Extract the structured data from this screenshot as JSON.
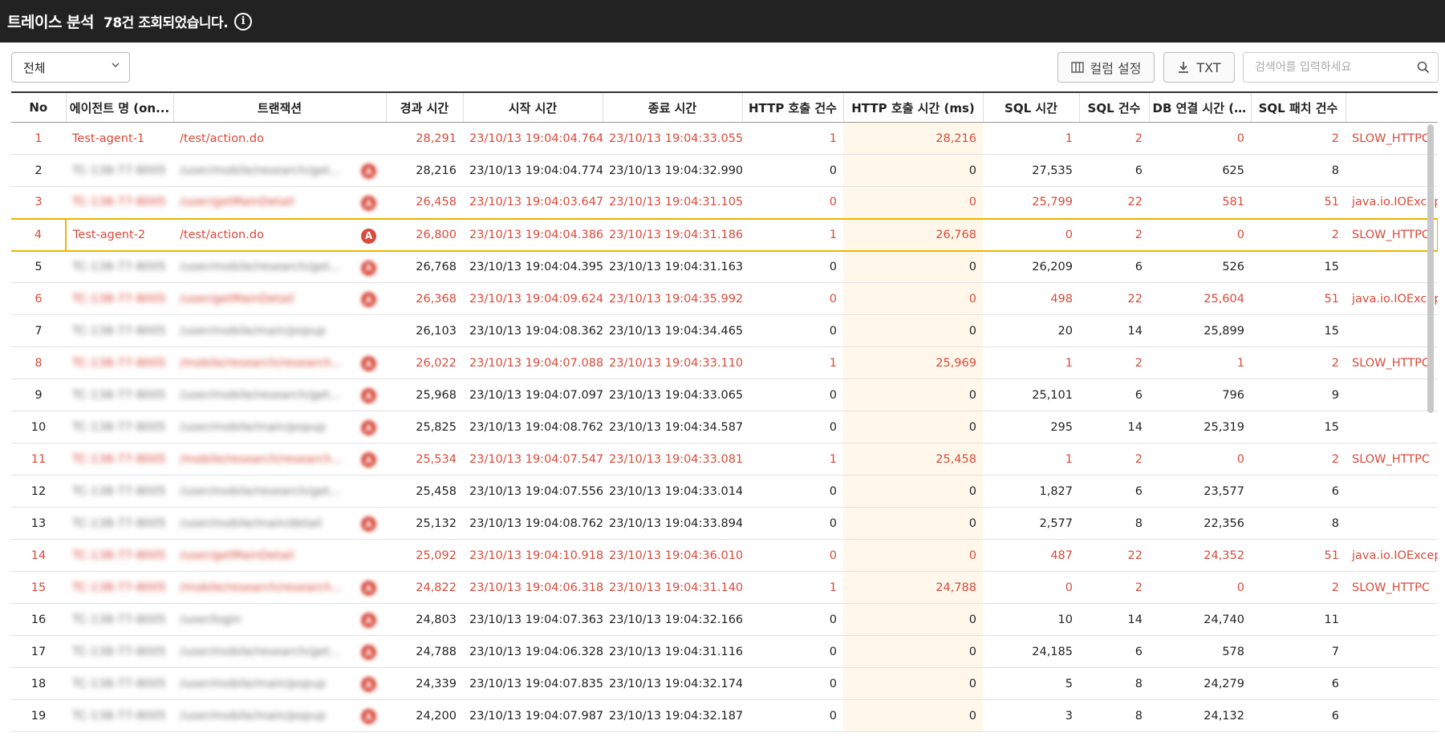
{
  "header": {
    "title": "트레이스 분석",
    "count_text": "78건 조회되었습니다.",
    "info_icon": "info-icon"
  },
  "toolbar": {
    "filter_value": "전체",
    "column_settings_label": "컬럼 설정",
    "txt_label": "TXT",
    "search_placeholder": "검색어를 입력하세요"
  },
  "table": {
    "columns": [
      "No",
      "에이전트 명 (on...",
      "트랜잭션",
      "경과 시간",
      "시작 시간",
      "종료 시간",
      "HTTP 호출 건수",
      "HTTP 호출 시간 (ms)",
      "SQL 시간",
      "SQL 건수",
      "DB 연결 시간 (...",
      "SQL 패치 건수",
      ""
    ],
    "rows": [
      {
        "no": "1",
        "agent": "Test-agent-1",
        "tx": "/test/action.do",
        "mark": "",
        "elapsed": "28,291",
        "start": "23/10/13 19:04:04.764",
        "end": "23/10/13 19:04:33.055",
        "http_cnt": "1",
        "http_time": "28,216",
        "sql_time": "1",
        "sql_cnt": "2",
        "db_conn": "0",
        "fetch": "2",
        "error": "SLOW_HTTPC",
        "err": true,
        "blur": false
      },
      {
        "no": "2",
        "agent": "TC-138-77-8005",
        "tx": "/user/mobile/research/get...",
        "mark": "A",
        "elapsed": "28,216",
        "start": "23/10/13 19:04:04.774",
        "end": "23/10/13 19:04:32.990",
        "http_cnt": "0",
        "http_time": "0",
        "sql_time": "27,535",
        "sql_cnt": "6",
        "db_conn": "625",
        "fetch": "8",
        "error": "",
        "err": false,
        "blur": true
      },
      {
        "no": "3",
        "agent": "TC-138-77-8005",
        "tx": "/user/getMainDetail",
        "mark": "A",
        "elapsed": "26,458",
        "start": "23/10/13 19:04:03.647",
        "end": "23/10/13 19:04:31.105",
        "http_cnt": "0",
        "http_time": "0",
        "sql_time": "25,799",
        "sql_cnt": "22",
        "db_conn": "581",
        "fetch": "51",
        "error": "java.io.IOExcept",
        "err": true,
        "blur": true
      },
      {
        "no": "4",
        "agent": "Test-agent-2",
        "tx": "/test/action.do",
        "mark": "A",
        "elapsed": "26,800",
        "start": "23/10/13 19:04:04.386",
        "end": "23/10/13 19:04:31.186",
        "http_cnt": "1",
        "http_time": "26,768",
        "sql_time": "0",
        "sql_cnt": "2",
        "db_conn": "0",
        "fetch": "2",
        "error": "SLOW_HTTPC",
        "err": true,
        "blur": false,
        "sel": true
      },
      {
        "no": "5",
        "agent": "TC-138-77-8005",
        "tx": "/user/mobile/research/get...",
        "mark": "A",
        "elapsed": "26,768",
        "start": "23/10/13 19:04:04.395",
        "end": "23/10/13 19:04:31.163",
        "http_cnt": "0",
        "http_time": "0",
        "sql_time": "26,209",
        "sql_cnt": "6",
        "db_conn": "526",
        "fetch": "15",
        "error": "",
        "err": false,
        "blur": true
      },
      {
        "no": "6",
        "agent": "TC-138-77-8005",
        "tx": "/user/getMainDetail",
        "mark": "A",
        "elapsed": "26,368",
        "start": "23/10/13 19:04:09.624",
        "end": "23/10/13 19:04:35.992",
        "http_cnt": "0",
        "http_time": "0",
        "sql_time": "498",
        "sql_cnt": "22",
        "db_conn": "25,604",
        "fetch": "51",
        "error": "java.io.IOExcept",
        "err": true,
        "blur": true
      },
      {
        "no": "7",
        "agent": "TC-138-77-8005",
        "tx": "/user/mobile/main/popup",
        "mark": "",
        "elapsed": "26,103",
        "start": "23/10/13 19:04:08.362",
        "end": "23/10/13 19:04:34.465",
        "http_cnt": "0",
        "http_time": "0",
        "sql_time": "20",
        "sql_cnt": "14",
        "db_conn": "25,899",
        "fetch": "15",
        "error": "",
        "err": false,
        "blur": true
      },
      {
        "no": "8",
        "agent": "TC-138-77-8005",
        "tx": "/mobile/research/research...",
        "mark": "A",
        "elapsed": "26,022",
        "start": "23/10/13 19:04:07.088",
        "end": "23/10/13 19:04:33.110",
        "http_cnt": "1",
        "http_time": "25,969",
        "sql_time": "1",
        "sql_cnt": "2",
        "db_conn": "1",
        "fetch": "2",
        "error": "SLOW_HTTPC",
        "err": true,
        "blur": true
      },
      {
        "no": "9",
        "agent": "TC-138-77-8005",
        "tx": "/user/mobile/research/get...",
        "mark": "A",
        "elapsed": "25,968",
        "start": "23/10/13 19:04:07.097",
        "end": "23/10/13 19:04:33.065",
        "http_cnt": "0",
        "http_time": "0",
        "sql_time": "25,101",
        "sql_cnt": "6",
        "db_conn": "796",
        "fetch": "9",
        "error": "",
        "err": false,
        "blur": true
      },
      {
        "no": "10",
        "agent": "TC-138-77-8005",
        "tx": "/user/mobile/main/popup",
        "mark": "A",
        "elapsed": "25,825",
        "start": "23/10/13 19:04:08.762",
        "end": "23/10/13 19:04:34.587",
        "http_cnt": "0",
        "http_time": "0",
        "sql_time": "295",
        "sql_cnt": "14",
        "db_conn": "25,319",
        "fetch": "15",
        "error": "",
        "err": false,
        "blur": true
      },
      {
        "no": "11",
        "agent": "TC-138-77-8005",
        "tx": "/mobile/research/research...",
        "mark": "A",
        "elapsed": "25,534",
        "start": "23/10/13 19:04:07.547",
        "end": "23/10/13 19:04:33.081",
        "http_cnt": "1",
        "http_time": "25,458",
        "sql_time": "1",
        "sql_cnt": "2",
        "db_conn": "0",
        "fetch": "2",
        "error": "SLOW_HTTPC",
        "err": true,
        "blur": true
      },
      {
        "no": "12",
        "agent": "TC-138-77-8005",
        "tx": "/user/mobile/research/get...",
        "mark": "",
        "elapsed": "25,458",
        "start": "23/10/13 19:04:07.556",
        "end": "23/10/13 19:04:33.014",
        "http_cnt": "0",
        "http_time": "0",
        "sql_time": "1,827",
        "sql_cnt": "6",
        "db_conn": "23,577",
        "fetch": "6",
        "error": "",
        "err": false,
        "blur": true
      },
      {
        "no": "13",
        "agent": "TC-138-77-8005",
        "tx": "/user/mobile/main/detail",
        "mark": "A",
        "elapsed": "25,132",
        "start": "23/10/13 19:04:08.762",
        "end": "23/10/13 19:04:33.894",
        "http_cnt": "0",
        "http_time": "0",
        "sql_time": "2,577",
        "sql_cnt": "8",
        "db_conn": "22,356",
        "fetch": "8",
        "error": "",
        "err": false,
        "blur": true
      },
      {
        "no": "14",
        "agent": "TC-138-77-8005",
        "tx": "/user/getMainDetail",
        "mark": "",
        "elapsed": "25,092",
        "start": "23/10/13 19:04:10.918",
        "end": "23/10/13 19:04:36.010",
        "http_cnt": "0",
        "http_time": "0",
        "sql_time": "487",
        "sql_cnt": "22",
        "db_conn": "24,352",
        "fetch": "51",
        "error": "java.io.IOExcept",
        "err": true,
        "blur": true
      },
      {
        "no": "15",
        "agent": "TC-138-77-8005",
        "tx": "/mobile/research/research...",
        "mark": "A",
        "elapsed": "24,822",
        "start": "23/10/13 19:04:06.318",
        "end": "23/10/13 19:04:31.140",
        "http_cnt": "1",
        "http_time": "24,788",
        "sql_time": "0",
        "sql_cnt": "2",
        "db_conn": "0",
        "fetch": "2",
        "error": "SLOW_HTTPC",
        "err": true,
        "blur": true
      },
      {
        "no": "16",
        "agent": "TC-138-77-8005",
        "tx": "/user/login",
        "mark": "A",
        "elapsed": "24,803",
        "start": "23/10/13 19:04:07.363",
        "end": "23/10/13 19:04:32.166",
        "http_cnt": "0",
        "http_time": "0",
        "sql_time": "10",
        "sql_cnt": "14",
        "db_conn": "24,740",
        "fetch": "11",
        "error": "",
        "err": false,
        "blur": true
      },
      {
        "no": "17",
        "agent": "TC-138-77-8005",
        "tx": "/user/mobile/research/get...",
        "mark": "A",
        "elapsed": "24,788",
        "start": "23/10/13 19:04:06.328",
        "end": "23/10/13 19:04:31.116",
        "http_cnt": "0",
        "http_time": "0",
        "sql_time": "24,185",
        "sql_cnt": "6",
        "db_conn": "578",
        "fetch": "7",
        "error": "",
        "err": false,
        "blur": true
      },
      {
        "no": "18",
        "agent": "TC-138-77-8005",
        "tx": "/user/mobile/main/popup",
        "mark": "A",
        "elapsed": "24,339",
        "start": "23/10/13 19:04:07.835",
        "end": "23/10/13 19:04:32.174",
        "http_cnt": "0",
        "http_time": "0",
        "sql_time": "5",
        "sql_cnt": "8",
        "db_conn": "24,279",
        "fetch": "6",
        "error": "",
        "err": false,
        "blur": true
      },
      {
        "no": "19",
        "agent": "TC-138-77-8005",
        "tx": "/user/mobile/main/popup",
        "mark": "A",
        "elapsed": "24,200",
        "start": "23/10/13 19:04:07.987",
        "end": "23/10/13 19:04:32.187",
        "http_cnt": "0",
        "http_time": "0",
        "sql_time": "3",
        "sql_cnt": "8",
        "db_conn": "24,132",
        "fetch": "6",
        "error": "",
        "err": false,
        "blur": true
      }
    ]
  }
}
